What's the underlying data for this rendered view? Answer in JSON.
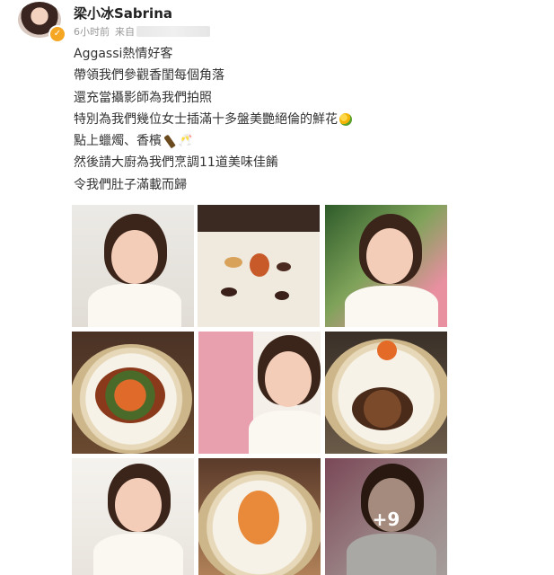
{
  "post": {
    "username": "梁小冰Sabrina",
    "time_label": "6小时前",
    "source_label": "来自",
    "lines": [
      "Aggassi熱情好客",
      "帶領我們參觀香閨每個角落",
      "還充當攝影師為我們拍照",
      "特別為我們幾位女士插滿十多盤美艷絕倫的鮮花",
      "點上蠟燭、香檳",
      "然後請大廚為我們烹調11道美味佳餚",
      "令我們肚子滿載而歸"
    ],
    "more_count_label": "+9"
  },
  "icons": {
    "verified": "verified-badge-icon",
    "flower": "flower-bouquet-icon",
    "bottle": "champagne-bottle-icon",
    "glasses": "clinking-glasses-icon"
  },
  "colors": {
    "verified_badge": "#f5a623",
    "text": "#333333",
    "meta": "#999999"
  }
}
